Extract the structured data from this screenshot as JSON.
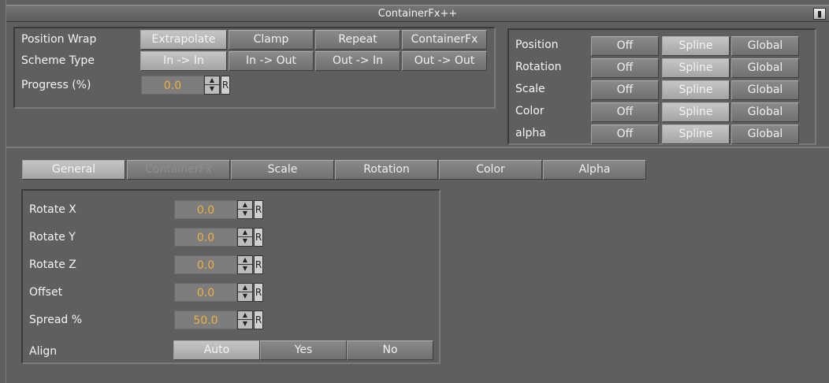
{
  "window": {
    "title": "ContainerFx++"
  },
  "wrap": {
    "position_wrap_label": "Position Wrap",
    "scheme_type_label": "Scheme Type",
    "progress_label": "Progress (%)",
    "position_wrap_options": [
      "Extrapolate",
      "Clamp",
      "Repeat",
      "ContainerFx"
    ],
    "position_wrap_selected": "Extrapolate",
    "scheme_type_options": [
      "In -> In",
      "In -> Out",
      "Out -> In",
      "Out -> Out"
    ],
    "scheme_type_selected": "In -> In",
    "progress_value": "0.0",
    "reset_label": "R"
  },
  "channels": {
    "rows": [
      {
        "label": "Position",
        "selected": "Spline"
      },
      {
        "label": "Rotation",
        "selected": "Spline"
      },
      {
        "label": "Scale",
        "selected": "Spline"
      },
      {
        "label": "Color",
        "selected": "Spline"
      },
      {
        "label": "alpha",
        "selected": "Spline"
      }
    ],
    "options": [
      "Off",
      "Spline",
      "Global"
    ]
  },
  "tabs": {
    "items": [
      "General",
      "ContainerFx",
      "Scale",
      "Rotation",
      "Color",
      "Alpha"
    ],
    "active": "General",
    "disabled": "ContainerFx"
  },
  "rotation": {
    "fields": [
      {
        "label": "Rotate X",
        "value": "0.0"
      },
      {
        "label": "Rotate Y",
        "value": "0.0"
      },
      {
        "label": "Rotate Z",
        "value": "0.0"
      },
      {
        "label": "Offset",
        "value": "0.0"
      },
      {
        "label": "Spread %",
        "value": "50.0"
      }
    ],
    "align_label": "Align",
    "align_options": [
      "Auto",
      "Yes",
      "No"
    ],
    "align_selected": "Auto",
    "reset_label": "R"
  }
}
